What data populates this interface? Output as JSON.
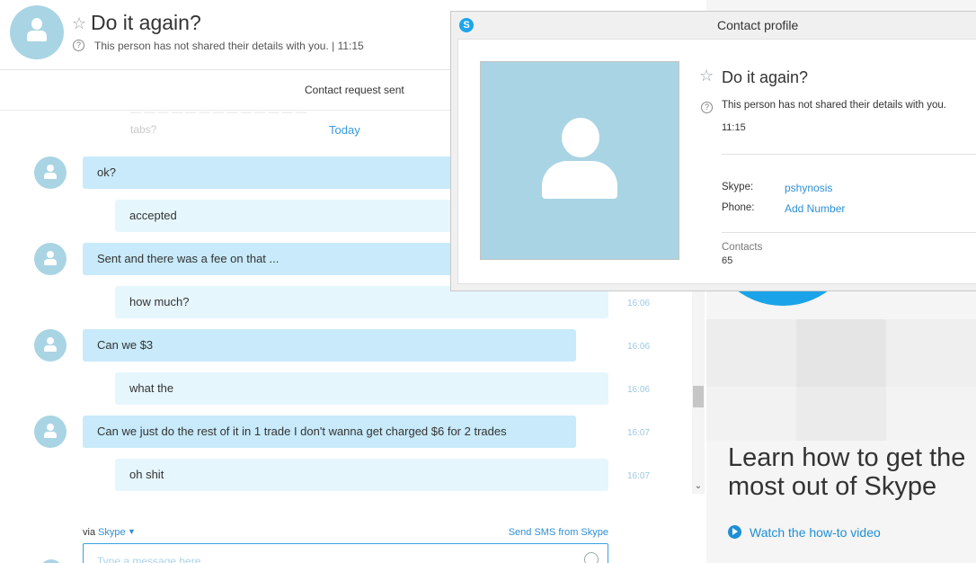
{
  "header": {
    "name": "Do it again?",
    "status": "This person has not shared their details with you.  |  11:15"
  },
  "request_bar": {
    "text": "Contact request sent"
  },
  "conversation": {
    "faded_text_1": "tabs?",
    "faded_text_2": "— — — — — — — — — — — — —",
    "date_divider": "Today",
    "messages": [
      {
        "sender": "them",
        "text": "ok?",
        "time": ""
      },
      {
        "sender": "me",
        "text": "accepted",
        "time": ""
      },
      {
        "sender": "them",
        "text": "Sent and there was a fee on that ...",
        "time": ""
      },
      {
        "sender": "me",
        "text": "how much?",
        "time": "16:06"
      },
      {
        "sender": "them",
        "text": "Can we $3",
        "time": "16:06"
      },
      {
        "sender": "me",
        "text": "what the",
        "time": "16:06"
      },
      {
        "sender": "them",
        "text": "Can we just do the rest of it in 1 trade I don't wanna get charged $6 for 2 trades",
        "time": "16:07"
      },
      {
        "sender": "me",
        "text": "oh shit",
        "time": "16:07"
      }
    ]
  },
  "compose": {
    "via_label": "via",
    "via_service": "Skype",
    "send_sms": "Send SMS from Skype",
    "placeholder": "Type a message here"
  },
  "right_panel": {
    "headline": "Learn how to get the most out of Skype",
    "watch_link": "Watch the how-to video",
    "accent_color": "#1aa3e8"
  },
  "profile_popup": {
    "title": "Contact profile",
    "logo_letter": "S",
    "name": "Do it again?",
    "status": "This person has not shared their details with you.",
    "time": "11:15",
    "skype_label": "Skype:",
    "skype_value": "pshynosis",
    "phone_label": "Phone:",
    "phone_value": "Add Number",
    "contacts_label": "Contacts",
    "contacts_value": "65"
  },
  "colors": {
    "their_bubble": "#c8eafa",
    "my_bubble": "#e6f6fd",
    "avatar": "#a9d4e4",
    "link": "#2f8fd3"
  }
}
